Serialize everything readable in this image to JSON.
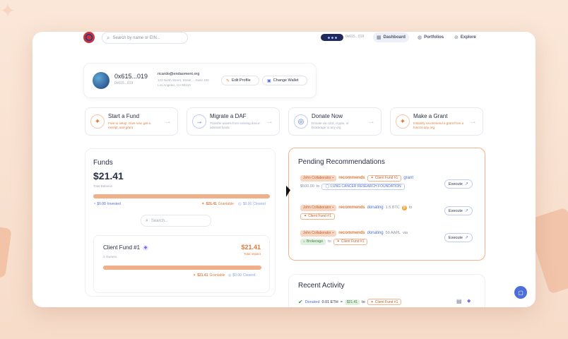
{
  "topbar": {
    "search_placeholder": "Search by name or EIN...",
    "wallet_address": "0x615...019",
    "nav": [
      {
        "label": "Dashboard",
        "icon": "grid-icon",
        "active": true
      },
      {
        "label": "Portfolios",
        "icon": "portfolio-icon",
        "active": false
      },
      {
        "label": "Explore",
        "icon": "compass-icon",
        "active": false
      }
    ]
  },
  "profile": {
    "name": "0x615...019",
    "sub": "0x615...019",
    "email": "ricardo@endaoment.org",
    "address_line1": "123 North Street, Street, ...Suite 100",
    "address_line2": "Los Angeles, CA 90210",
    "edit_label": "Edit Profile",
    "change_wallet_label": "Change Wallet"
  },
  "actions": [
    {
      "title": "Start a Fund",
      "desc": "Free to setup. Give now, get a receipt, and grant",
      "icon": "sparkle-icon"
    },
    {
      "title": "Migrate a DAF",
      "desc": "Transfer assets from existing donor-advised funds",
      "icon": "arrow-right-circle-icon"
    },
    {
      "title": "Donate Now",
      "desc": "Donate via card, crypto, or brokerage to any org",
      "icon": "ring-icon"
    },
    {
      "title": "Make a Grant",
      "desc": "Instantly recommend a grant from a fund to any org",
      "icon": "sparkle-icon"
    }
  ],
  "funds": {
    "title": "Funds",
    "amount": "$21.41",
    "amount_label": "Total Balance",
    "bar_fraction": 1.0,
    "invested": "$0.00",
    "invested_label": "Invested",
    "grantable": "$21.41",
    "grantable_label": "Grantable",
    "cleared": "$0.00",
    "cleared_label": "Cleared",
    "search_placeholder": "Search...",
    "items": [
      {
        "name": "Client Fund #1",
        "sub": "3 Owners",
        "amount": "$21.41",
        "amount_label": "Total impact",
        "bar_fraction": 1.0,
        "grantable": "$21.41",
        "grantable_label": "Grantable",
        "cleared": "$0.00",
        "cleared_label": "Cleared"
      }
    ]
  },
  "pending": {
    "title": "Pending Recommendations",
    "execute_label": "Execute",
    "rec1": {
      "who": "John Collaborator",
      "verb": "recommends",
      "fund": "Client Fund #1",
      "kind": "grant",
      "amount": "$500.00",
      "to": "to",
      "org": "LUNG CANCER RESEARCH FOUNDATION"
    },
    "rec2": {
      "who": "John Collaborator",
      "verb": "recommends",
      "kind": "donating",
      "amount": "1.5 BTC",
      "to": "to",
      "fund": "Client Fund #1"
    },
    "rec3": {
      "who": "John Collaborator",
      "verb": "recommends",
      "kind": "donating",
      "amount": "50 AAPL",
      "via": "via",
      "source": "Brokerage",
      "to": "to",
      "fund": "Client Fund #1"
    }
  },
  "recent": {
    "title": "Recent Activity",
    "item": {
      "action": "Donated",
      "asset": "0.01 ETH",
      "eq": "≈",
      "value": "$21.41",
      "to": "to",
      "fund": "Client Fund #1"
    }
  },
  "colors": {
    "accent_orange": "#e07a3a",
    "accent_blue": "#4f6fd8",
    "nav_dark": "#1f2a5a"
  }
}
